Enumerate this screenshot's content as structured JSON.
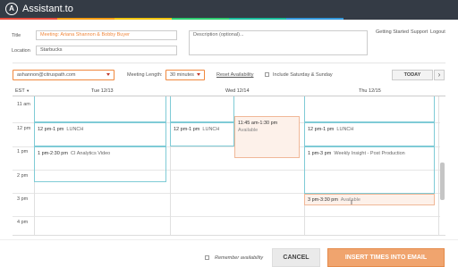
{
  "app": {
    "title": "Assistant.to",
    "logo_letter": "A"
  },
  "colors": {
    "topbar": "#343b45",
    "accent": "#f0883e",
    "event_border": "#7fcbd6",
    "available_bg": "#fdf1ea",
    "strip": [
      "#e74c3c",
      "#f39c12",
      "#f1c40f",
      "#2ecc71",
      "#1abc9c",
      "#3498db"
    ]
  },
  "top_links": {
    "getting_started": "Getting Started",
    "support": "Support",
    "logout": "Logout"
  },
  "form": {
    "title_label": "Title",
    "title_value": "Meeting: Ariana Shannon & Bobby Buyer",
    "location_label": "Location",
    "location_value": "Starbucks",
    "description_placeholder": "Description (optional)..."
  },
  "controls": {
    "email": "ashannon@citruspath.com",
    "meeting_length_label": "Meeting Length:",
    "meeting_length_value": "30 minutes",
    "reset_label": "Reset Availability",
    "weekend_label": "Include Saturday & Sunday",
    "today_label": "TODAY",
    "next_icon": "›"
  },
  "calendar": {
    "timezone": "EST",
    "days": [
      "Tue 12/13",
      "Wed 12/14",
      "Thu 12/15"
    ],
    "times": [
      "11 am",
      "12 pm",
      "1 pm",
      "2 pm",
      "3 pm",
      "4 pm"
    ],
    "events": {
      "tue_lunch_time": "12 pm-1 pm",
      "tue_lunch_title": "LUNCH",
      "tue_video_time": "1 pm-2:30 pm",
      "tue_video_title": "CI Analytics Video",
      "wed_lunch_time": "12 pm-1 pm",
      "wed_lunch_title": "LUNCH",
      "wed_avail_time": "11:45 am-1:30 pm",
      "wed_avail_title": "Available",
      "thu_lunch_time": "12 pm-1 pm",
      "thu_lunch_title": "LUNCH",
      "thu_insight_time": "1 pm-3 pm",
      "thu_insight_title": "Weekly Insight - Post Production",
      "thu_avail_time": "3 pm-3:30 pm",
      "thu_avail_title": "Available"
    }
  },
  "footer": {
    "remember_label": "Remember availability",
    "cancel_label": "CANCEL",
    "insert_label": "INSERT TIMES INTO EMAIL"
  }
}
